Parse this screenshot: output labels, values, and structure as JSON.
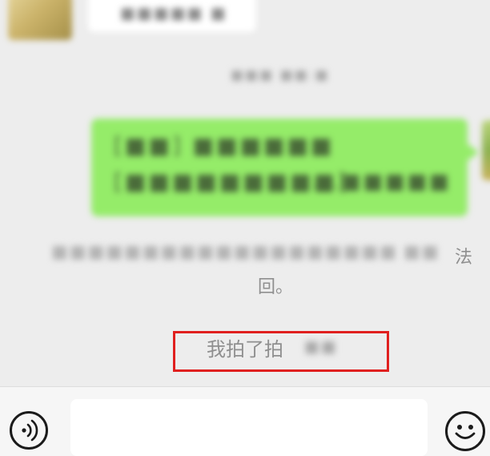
{
  "chat": {
    "incoming_message": {
      "preview_text": "■■■■■ ■"
    },
    "timestamp": "■■■ ■■:■",
    "outgoing_message": {
      "line1": "[■■] ■■■■■■",
      "line2": "[■■■■■■■■■]",
      "line2_suffix": "...■■■■■"
    },
    "system_notice": {
      "line1_hidden": "■■■■■■■■■■■■■■■■■■■■■",
      "line1_hidden_tail": "■■",
      "visible_fragment_1": "法",
      "visible_fragment_2": "回。"
    },
    "pat_notice": {
      "prefix": "我拍了拍",
      "name_hidden": "■■"
    }
  },
  "input_bar": {
    "voice_icon": "voice-wave-icon",
    "emoji_icon": "smiley-face-icon",
    "message_value": ""
  },
  "colors": {
    "chat_background": "#ededed",
    "outgoing_bubble": "#95ec69",
    "highlight_box": "#e0201f",
    "input_bar": "#f6f6f6"
  }
}
